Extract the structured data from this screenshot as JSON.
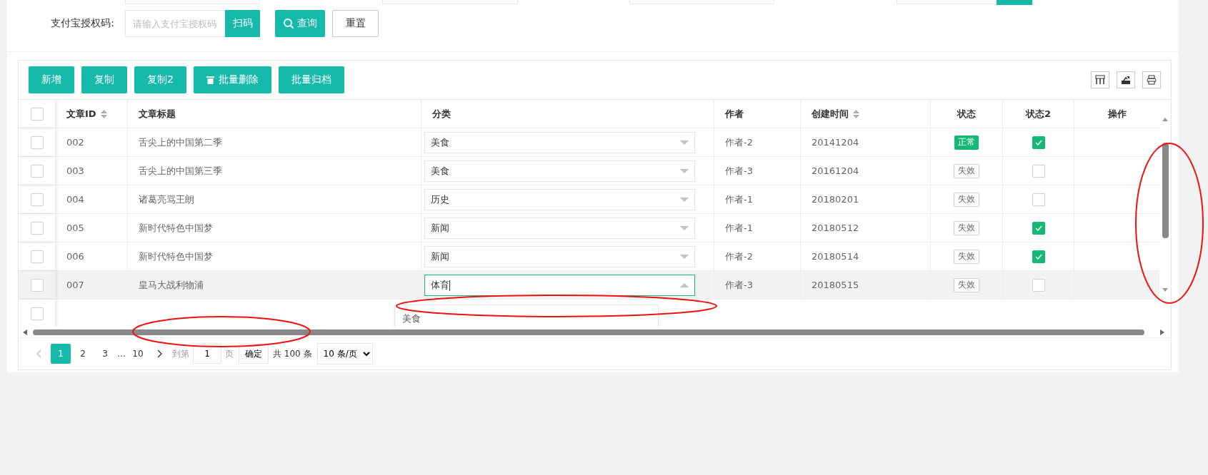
{
  "upper_fields": [
    {
      "kind": "input"
    },
    {
      "kind": "input"
    },
    {
      "kind": "input"
    },
    {
      "kind": "input-with-button"
    }
  ],
  "query_form": {
    "label": "支付宝授权码:",
    "placeholder": "请输入支付宝授权码",
    "scan_button": "扫码",
    "search_button": "查询",
    "reset_button": "重置"
  },
  "toolbar": {
    "buttons": [
      {
        "label": "新增",
        "kind": "plain"
      },
      {
        "label": "复制",
        "kind": "plain"
      },
      {
        "label": "复制2",
        "kind": "plain"
      },
      {
        "label": "批量删除",
        "kind": "delete"
      },
      {
        "label": "批量归档",
        "kind": "plain"
      }
    ],
    "tools": [
      {
        "kind": "columns"
      },
      {
        "kind": "export"
      },
      {
        "kind": "print"
      }
    ]
  },
  "table": {
    "all_checked": false,
    "columns": [
      {
        "label": "文章ID",
        "sortable": true
      },
      {
        "label": "文章标题",
        "sortable": false
      },
      {
        "label": "分类",
        "sortable": false
      },
      {
        "label": "作者",
        "sortable": false
      },
      {
        "label": "创建时间",
        "sortable": true
      },
      {
        "label": "状态",
        "sortable": false
      },
      {
        "label": "状态2",
        "sortable": false
      },
      {
        "label": "操作",
        "sortable": false
      }
    ],
    "rows": [
      {
        "checked": false,
        "hovered": false,
        "id": "002",
        "title": "舌尖上的中国第二季",
        "category": "美食",
        "open": false,
        "author": "作者-2",
        "created": "20141204",
        "status": "正常",
        "status_active": true,
        "status2": true
      },
      {
        "checked": false,
        "hovered": false,
        "id": "003",
        "title": "舌尖上的中国第三季",
        "category": "美食",
        "open": false,
        "author": "作者-3",
        "created": "20161204",
        "status": "失效",
        "status_active": false,
        "status2": false
      },
      {
        "checked": false,
        "hovered": false,
        "id": "004",
        "title": "诸葛亮骂王朗",
        "category": "历史",
        "open": false,
        "author": "作者-1",
        "created": "20180201",
        "status": "失效",
        "status_active": false,
        "status2": false
      },
      {
        "checked": false,
        "hovered": false,
        "id": "005",
        "title": "新时代特色中国梦",
        "category": "新闻",
        "open": false,
        "author": "作者-1",
        "created": "20180512",
        "status": "失效",
        "status_active": false,
        "status2": true
      },
      {
        "checked": false,
        "hovered": false,
        "id": "006",
        "title": "新时代特色中国梦",
        "category": "新闻",
        "open": false,
        "author": "作者-2",
        "created": "20180514",
        "status": "失效",
        "status_active": false,
        "status2": true
      },
      {
        "checked": false,
        "hovered": true,
        "id": "007",
        "title": "皇马大战利物浦",
        "category": "体育",
        "open": true,
        "author": "作者-3",
        "created": "20180515",
        "status": "失效",
        "status_active": false,
        "status2": false
      }
    ],
    "blank_row": {
      "checked": false
    },
    "dropdown_options": [
      "美食"
    ]
  },
  "pager": {
    "pages": [
      {
        "label": "1",
        "selected": true,
        "kind": "page"
      },
      {
        "label": "2",
        "selected": false,
        "kind": "page"
      },
      {
        "label": "3",
        "selected": false,
        "kind": "page"
      },
      {
        "label": "…",
        "selected": false,
        "kind": "ellipsis"
      },
      {
        "label": "10",
        "selected": false,
        "kind": "page"
      }
    ],
    "goto_prefix": "到第",
    "goto_value": "1",
    "goto_suffix": "页",
    "confirm": "确定",
    "total": "共 100 条",
    "page_size": "10 条/页"
  },
  "annotations": [
    {
      "kind": "ellipse"
    },
    {
      "kind": "ellipse"
    },
    {
      "kind": "ellipse"
    }
  ]
}
